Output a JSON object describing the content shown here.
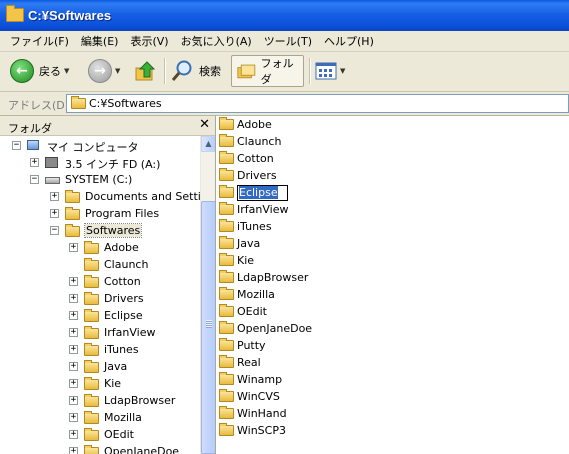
{
  "window": {
    "title": "C:¥Softwares"
  },
  "menu": [
    {
      "label": "ファイル(F)",
      "name": "menu-file"
    },
    {
      "label": "編集(E)",
      "name": "menu-edit"
    },
    {
      "label": "表示(V)",
      "name": "menu-view"
    },
    {
      "label": "お気に入り(A)",
      "name": "menu-favorites"
    },
    {
      "label": "ツール(T)",
      "name": "menu-tools"
    },
    {
      "label": "ヘルプ(H)",
      "name": "menu-help"
    }
  ],
  "toolbar": {
    "back_label": "戻る",
    "search_label": "検索",
    "folders_label": "フォルダ",
    "back_icon": "left-arrow",
    "forward_icon": "right-arrow",
    "up_icon": "up-folder",
    "search_icon": "magnifier",
    "views_icon": "views-grid"
  },
  "address": {
    "label": "アドレス(D)",
    "value": "C:¥Softwares"
  },
  "folders_pane": {
    "title": "フォルダ",
    "close_glyph": "✕",
    "tree": [
      {
        "label": "マイ コンピュータ",
        "level": 0,
        "expander": "−",
        "icon": "computer"
      },
      {
        "label": "3.5 インチ FD (A:)",
        "level": 1,
        "expander": "+",
        "icon": "floppy"
      },
      {
        "label": "SYSTEM (C:)",
        "level": 1,
        "expander": "−",
        "icon": "drive"
      },
      {
        "label": "Documents and Settin",
        "level": 2,
        "expander": "+",
        "icon": "folder"
      },
      {
        "label": "Program Files",
        "level": 2,
        "expander": "+",
        "icon": "folder"
      },
      {
        "label": "Softwares",
        "level": 2,
        "expander": "−",
        "icon": "folder",
        "selected": true
      },
      {
        "label": "Adobe",
        "level": 3,
        "expander": "+",
        "icon": "folder"
      },
      {
        "label": "Claunch",
        "level": 3,
        "expander": "",
        "icon": "folder"
      },
      {
        "label": "Cotton",
        "level": 3,
        "expander": "+",
        "icon": "folder"
      },
      {
        "label": "Drivers",
        "level": 3,
        "expander": "+",
        "icon": "folder"
      },
      {
        "label": "Eclipse",
        "level": 3,
        "expander": "+",
        "icon": "folder"
      },
      {
        "label": "IrfanView",
        "level": 3,
        "expander": "+",
        "icon": "folder"
      },
      {
        "label": "iTunes",
        "level": 3,
        "expander": "+",
        "icon": "folder"
      },
      {
        "label": "Java",
        "level": 3,
        "expander": "+",
        "icon": "folder"
      },
      {
        "label": "Kie",
        "level": 3,
        "expander": "+",
        "icon": "folder"
      },
      {
        "label": "LdapBrowser",
        "level": 3,
        "expander": "+",
        "icon": "folder"
      },
      {
        "label": "Mozilla",
        "level": 3,
        "expander": "+",
        "icon": "folder"
      },
      {
        "label": "OEdit",
        "level": 3,
        "expander": "+",
        "icon": "folder"
      },
      {
        "label": "OpenJaneDoe",
        "level": 3,
        "expander": "+",
        "icon": "folder"
      }
    ]
  },
  "content": {
    "items": [
      {
        "label": "Adobe"
      },
      {
        "label": "Claunch"
      },
      {
        "label": "Cotton"
      },
      {
        "label": "Drivers"
      },
      {
        "label": "Eclipse",
        "renaming": true
      },
      {
        "label": "IrfanView"
      },
      {
        "label": "iTunes"
      },
      {
        "label": "Java"
      },
      {
        "label": "Kie"
      },
      {
        "label": "LdapBrowser"
      },
      {
        "label": "Mozilla"
      },
      {
        "label": "OEdit"
      },
      {
        "label": "OpenJaneDoe"
      },
      {
        "label": "Putty"
      },
      {
        "label": "Real"
      },
      {
        "label": "Winamp"
      },
      {
        "label": "WinCVS"
      },
      {
        "label": "WinHand"
      },
      {
        "label": "WinSCP3"
      }
    ]
  }
}
